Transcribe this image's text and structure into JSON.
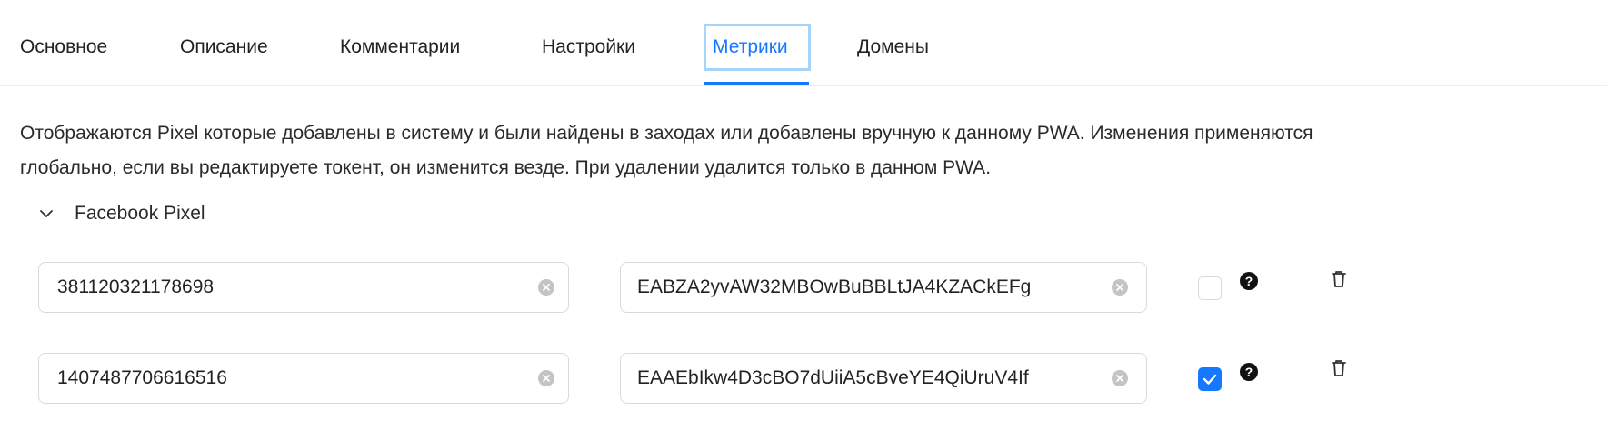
{
  "tabs": [
    {
      "label": "Основное",
      "active": false
    },
    {
      "label": "Описание",
      "active": false
    },
    {
      "label": "Комментарии",
      "active": false
    },
    {
      "label": "Настройки",
      "active": false
    },
    {
      "label": "Метрики",
      "active": true
    },
    {
      "label": "Домены",
      "active": false
    }
  ],
  "description": {
    "line1": "Отображаются Pixel которые добавлены в систему и были найдены в заходах или добавлены вручную к данному PWA. Изменения применяются",
    "line2": "глобально, если вы редактируете токент, он изменится везде. При удалении удалится только в данном PWA."
  },
  "section": {
    "title": "Facebook Pixel",
    "expanded": true,
    "icon": "chevron-down-icon"
  },
  "pixels": [
    {
      "pixel_id": "381120321178698",
      "token": "EABZA2yvAW32MBOwBuBBLtJA4KZACkEFg",
      "checked": false
    },
    {
      "pixel_id": "1407487706616516",
      "token": "EAAEbIkw4D3cBO7dUiiA5cBveYE4QiUruV4If",
      "checked": true
    }
  ],
  "icons": {
    "clear": "close-circle-icon",
    "help": "question-circle-icon",
    "delete": "trash-icon",
    "check": "check-icon"
  },
  "colors": {
    "accent": "#1677ff",
    "focus_ring": "#a8d4f8",
    "border": "#d9d9d9"
  }
}
